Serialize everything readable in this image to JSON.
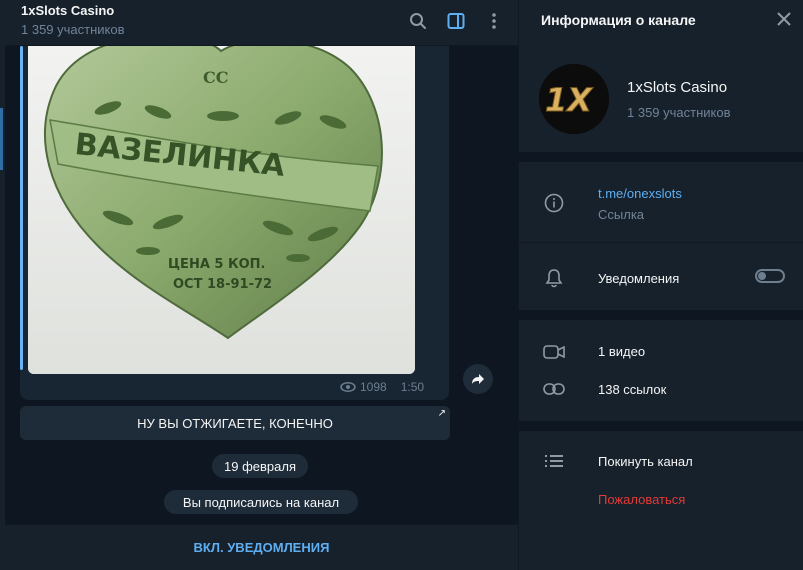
{
  "colors": {
    "accent": "#5eaef2",
    "danger": "#e53935",
    "panel": "#17212b",
    "bg": "#0e1621",
    "muted": "#708499"
  },
  "chat": {
    "title": "1xSlots Casino",
    "subtitle": "1 359 участников",
    "header_icons": [
      "search-icon",
      "sidebar-toggle-icon",
      "more-vertical-icon"
    ],
    "message": {
      "image_text": {
        "logo": "CC",
        "banner": "ВАЗЕЛИНКА",
        "price": "ЦЕНА 5 КОП.",
        "standard": "ОСТ 18-91-72"
      },
      "views": "1098",
      "time": "1:50",
      "button_label": "НУ ВЫ ОТЖИГАЕТЕ, КОНЕЧНО"
    },
    "date_pill": "19 февраля",
    "service_message": "Вы подписались на канал",
    "bottom_action": "ВКЛ. УВЕДОМЛЕНИЯ"
  },
  "info": {
    "title": "Информация о канале",
    "channel_name": "1xSlots Casino",
    "channel_sub": "1 359 участников",
    "avatar_text": "1X",
    "link": "t.me/onexslots",
    "link_caption": "Ссылка",
    "notifications_label": "Уведомления",
    "notifications_on": false,
    "videos": "1 видео",
    "links": "138 ссылок",
    "leave": "Покинуть канал",
    "report": "Пожаловаться"
  }
}
